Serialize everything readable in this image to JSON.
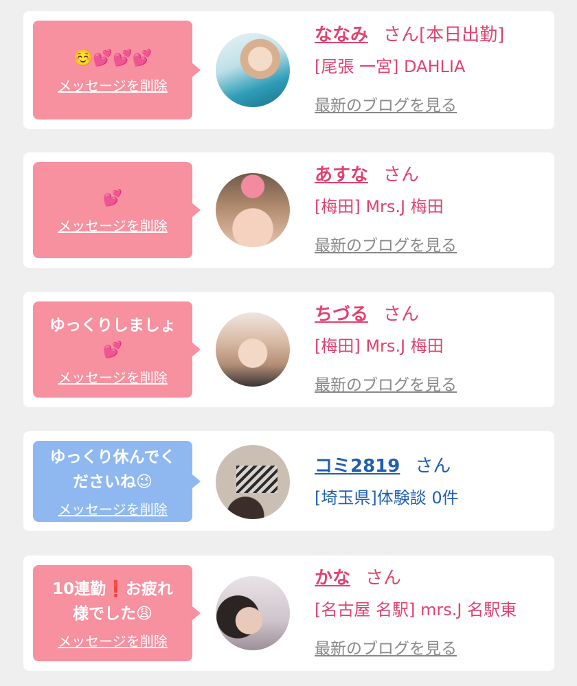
{
  "colors": {
    "pink_bubble": "#f7909f",
    "blue_bubble": "#8fb8f1",
    "pink_text": "#e0426e",
    "blue_text": "#1f5fae",
    "link_gray": "#888888"
  },
  "delete_label": "メッセージを削除",
  "blog_label": "最新のブログを見る",
  "san_label": "さん",
  "cards": [
    {
      "message": "☺️💕💕💕",
      "name": "ななみ",
      "status": "[本日出勤]",
      "shop": "[尾張 一宮] DAHLIA",
      "bubble_color": "pink"
    },
    {
      "message": "💕",
      "name": "あすな",
      "status": "",
      "shop": "[梅田] Mrs.J 梅田",
      "bubble_color": "pink"
    },
    {
      "message": "ゆっくりしましょ\n💕",
      "name": "ちづる",
      "status": "",
      "shop": "[梅田] Mrs.J 梅田",
      "bubble_color": "pink"
    },
    {
      "message": "ゆっくり休んでく\nださいね😉",
      "name": "コミ2819",
      "status": "",
      "shop": "[埼玉県]体験談 0件",
      "bubble_color": "blue"
    },
    {
      "message": "10連勤❗️お疲れ\n様でした😩",
      "name": "かな",
      "status": "",
      "shop": "[名古屋 名駅] mrs.J 名駅東",
      "bubble_color": "pink"
    }
  ]
}
